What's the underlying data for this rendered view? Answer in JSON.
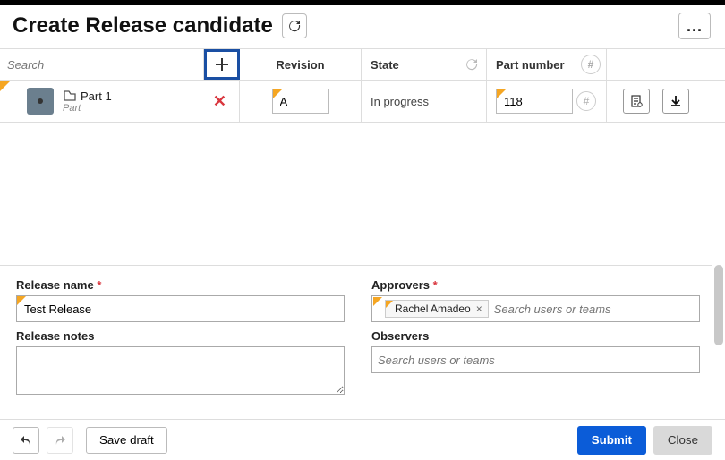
{
  "header": {
    "title": "Create Release candidate",
    "more_label": "..."
  },
  "search": {
    "placeholder": "Search"
  },
  "columns": {
    "revision": "Revision",
    "state": "State",
    "part_number": "Part number"
  },
  "row": {
    "name": "Part 1",
    "type": "Part",
    "revision": "A",
    "state": "In progress",
    "part_number": "118"
  },
  "form": {
    "release_name_label": "Release name",
    "release_name_value": "Test Release",
    "release_notes_label": "Release notes",
    "release_notes_value": "",
    "approvers_label": "Approvers",
    "approvers_chip": "Rachel Amadeo",
    "approvers_placeholder": "Search users or teams",
    "observers_label": "Observers",
    "observers_placeholder": "Search users or teams"
  },
  "footer": {
    "save_draft": "Save draft",
    "submit": "Submit",
    "close": "Close"
  }
}
